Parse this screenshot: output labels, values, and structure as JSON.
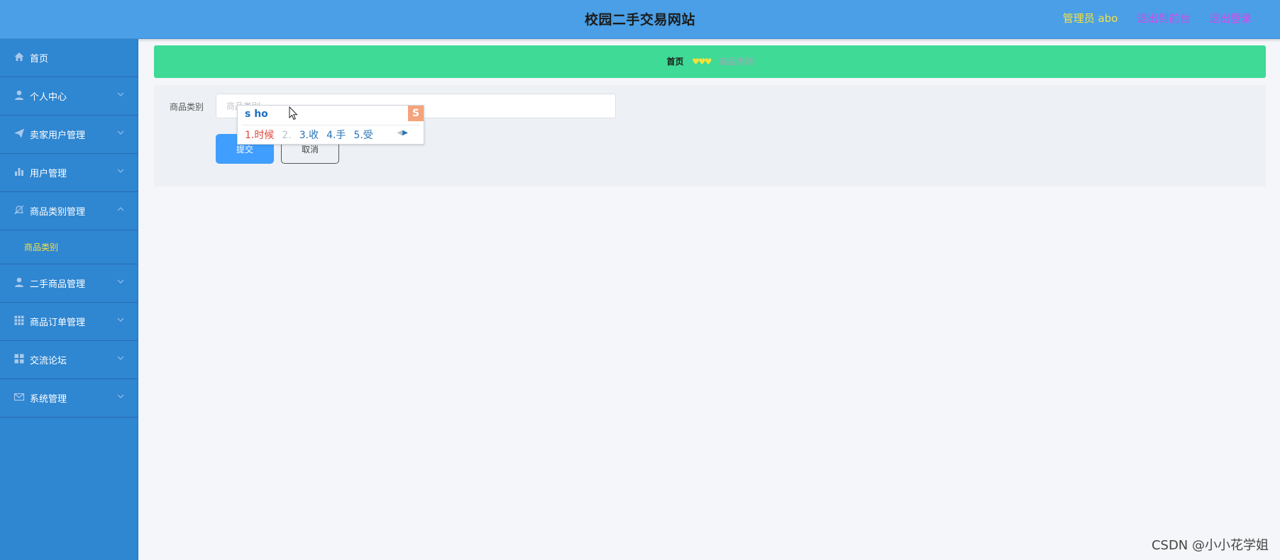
{
  "header": {
    "title": "校园二手交易网站",
    "user_label": "管理员 abo",
    "front_link": "退出到前台",
    "logout_link": "退出登录"
  },
  "sidebar": {
    "items": [
      {
        "label": "首页",
        "icon": "home-icon"
      },
      {
        "label": "个人中心",
        "icon": "user-icon"
      },
      {
        "label": "卖家用户管理",
        "icon": "paper-plane-icon"
      },
      {
        "label": "用户管理",
        "icon": "bar-chart-icon"
      },
      {
        "label": "商品类别管理",
        "icon": "bell-off-icon",
        "expanded": true,
        "children": [
          {
            "label": "商品类别"
          }
        ]
      },
      {
        "label": "二手商品管理",
        "icon": "user-icon"
      },
      {
        "label": "商品订单管理",
        "icon": "grid-icon"
      },
      {
        "label": "交流论坛",
        "icon": "apps-icon"
      },
      {
        "label": "系统管理",
        "icon": "mail-icon"
      }
    ]
  },
  "breadcrumb": {
    "home": "首页",
    "separator": "♥♥♥",
    "current": "商品类别"
  },
  "form": {
    "field_label": "商品类别",
    "field_placeholder": "商品类别",
    "field_value": "",
    "submit_label": "提交",
    "cancel_label": "取消"
  },
  "ime": {
    "composition": "s ho",
    "logo": "S",
    "candidates": [
      {
        "label": "1.时候",
        "active": true
      },
      {
        "label": "2.",
        "dim": true
      },
      {
        "label": "3.收"
      },
      {
        "label": "4.手"
      },
      {
        "label": "5.受"
      }
    ]
  },
  "watermark": "CSDN @小小花学姐",
  "colors": {
    "header_bg": "#4a9fe6",
    "sidebar_bg": "#2f86d1",
    "breadcrumb_bg": "#3fda96",
    "accent_yellow": "#f3e046",
    "link_magenta": "#d946ef",
    "submit_blue": "#409eff"
  }
}
